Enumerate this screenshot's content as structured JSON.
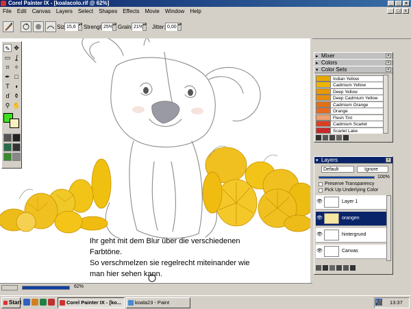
{
  "window": {
    "title": "Corel Painter IX - [koalacolo.rif @ 62%]",
    "buttons": [
      "_",
      "□",
      "×"
    ]
  },
  "menu": [
    "File",
    "Edit",
    "Canvas",
    "Layers",
    "Select",
    "Shapes",
    "Effects",
    "Movie",
    "Window",
    "Help"
  ],
  "property_bar": {
    "size_label": "Size:",
    "size_value": "15,6",
    "strength_label": "Strength:",
    "strength_value": "25%",
    "grain_label": "Grain:",
    "grain_value": "21%",
    "jitter_label": "Jitter:",
    "jitter_value": "0,00"
  },
  "canvas": {
    "caption": [
      "Ihr geht mit dem Blur über die verschiedenen",
      "Farbtöne.",
      "So verschmelzen sie regelrecht miteinander wie",
      "man hier sehen kann."
    ]
  },
  "panels": {
    "mixer": "Mixer",
    "colors": "Colors",
    "color_sets": {
      "title": "Color Sets",
      "swatches": [
        {
          "name": "Indian Yellow",
          "color": "#e8a800"
        },
        {
          "name": "Cadmium Yellow",
          "color": "#f0b400"
        },
        {
          "name": "Deep Yellow",
          "color": "#e89800"
        },
        {
          "name": "Deep Cadmium Yellow",
          "color": "#e88c10"
        },
        {
          "name": "Cadmium Orange",
          "color": "#e07018"
        },
        {
          "name": "Orange",
          "color": "#e86a20"
        },
        {
          "name": "Flesh Tint",
          "color": "#f0a070"
        },
        {
          "name": "Cadmium Scarlet",
          "color": "#d84020"
        },
        {
          "name": "Scarlet Lake",
          "color": "#c82828"
        }
      ]
    },
    "layers": {
      "title": "Layers",
      "composite_method": "Default",
      "composite_depth": "Ignore",
      "opacity": "100%",
      "preserve_transparency": "Preserve Transparency",
      "pick_up_underlying": "Pick Up Underlying Color",
      "items": [
        {
          "name": "Layer 1",
          "selected": false
        },
        {
          "name": "orangen",
          "selected": true
        },
        {
          "name": "hintergrund",
          "selected": false
        },
        {
          "name": "Canvas",
          "selected": false
        }
      ]
    }
  },
  "status": {
    "zoom": "62%"
  },
  "taskbar": {
    "start": "Start",
    "tasks": [
      {
        "label": "Corel Painter IX - [ko...",
        "active": true
      },
      {
        "label": "koala23 - Paint",
        "active": false
      }
    ],
    "lang": "DE",
    "clock": "13:37"
  },
  "colors": {
    "primary_swatch": "#40e020",
    "secondary_swatch": "#f8f0c0"
  }
}
